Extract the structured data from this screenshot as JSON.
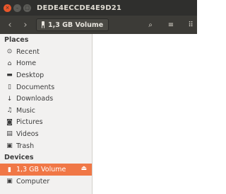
{
  "window": {
    "title": "DEDE4ECCDE4E9D21",
    "close_glyph": "×",
    "min_glyph": "–",
    "max_glyph": "□"
  },
  "toolbar": {
    "back_glyph": "‹",
    "forward_glyph": "›",
    "path_label": "1,3 GB Volume",
    "search_glyph": "⌕",
    "menu_glyph": "≡",
    "grid_glyph": "⠿"
  },
  "sidebar": {
    "places_header": "Places",
    "places": [
      {
        "label": "Recent",
        "icon": "clock-icon",
        "glyph": "⊙"
      },
      {
        "label": "Home",
        "icon": "home-icon",
        "glyph": "⌂"
      },
      {
        "label": "Desktop",
        "icon": "desktop-folder-icon",
        "glyph": "▬"
      },
      {
        "label": "Documents",
        "icon": "document-icon",
        "glyph": "▯"
      },
      {
        "label": "Downloads",
        "icon": "download-icon",
        "glyph": "↓"
      },
      {
        "label": "Music",
        "icon": "music-icon",
        "glyph": "♫"
      },
      {
        "label": "Pictures",
        "icon": "camera-icon",
        "glyph": "◙"
      },
      {
        "label": "Videos",
        "icon": "film-icon",
        "glyph": "▤"
      },
      {
        "label": "Trash",
        "icon": "trash-icon",
        "glyph": "▣"
      }
    ],
    "devices_header": "Devices",
    "devices": [
      {
        "label": "1,3 GB Volume",
        "icon": "usb-drive-icon",
        "glyph": "▮",
        "eject_glyph": "⏏",
        "active": true
      },
      {
        "label": "Computer",
        "icon": "computer-icon",
        "glyph": "▣"
      }
    ]
  },
  "colors": {
    "accent": "#f07746",
    "titlebar": "#2f2f2d",
    "toolbar": "#3c3b37",
    "sidebar": "#f2f1f0"
  }
}
